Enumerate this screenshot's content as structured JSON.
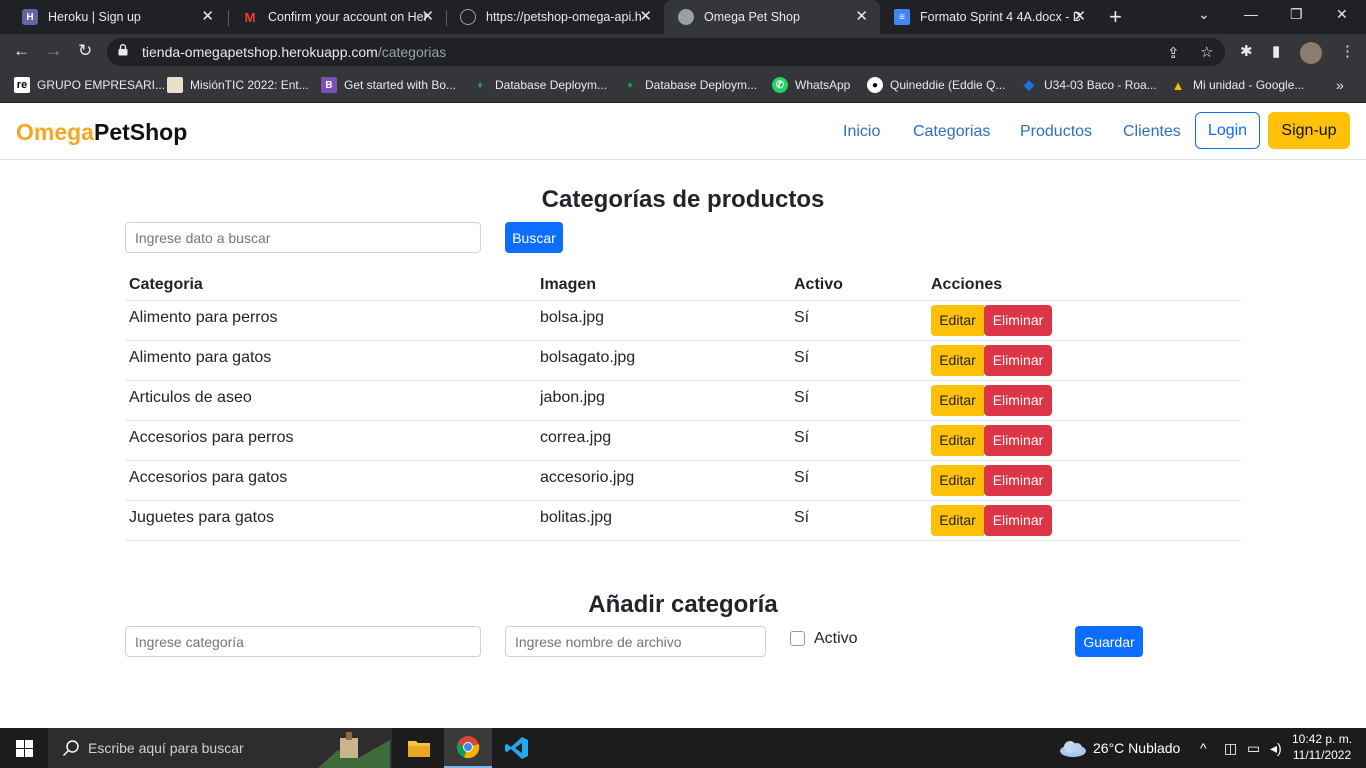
{
  "browser": {
    "tabs": [
      {
        "title": "Heroku | Sign up",
        "icon": "heroku-icon",
        "color": "#6762a6"
      },
      {
        "title": "Confirm your account on Her",
        "icon": "gmail-icon",
        "color": "#ea4335"
      },
      {
        "title": "https://petshop-omega-api.h",
        "icon": "globe-icon",
        "color": "#9aa0a6"
      },
      {
        "title": "Omega Pet Shop",
        "icon": "globe-icon",
        "color": "#9aa0a6"
      },
      {
        "title": "Formato Sprint 4 4A.docx - D",
        "icon": "docs-icon",
        "color": "#4285f4"
      }
    ],
    "url_host": "tienda-omegapetshop.herokuapp.com",
    "url_path": "/categorias",
    "bookmarks": [
      {
        "label": "GRUPO EMPRESARI...",
        "icon": "re-icon"
      },
      {
        "label": "MisiónTIC 2022: Ent...",
        "icon": "misiontic-icon"
      },
      {
        "label": "Get started with Bo...",
        "icon": "bootstrap-icon"
      },
      {
        "label": "Database Deploym...",
        "icon": "mongodb-icon"
      },
      {
        "label": "Database Deploym...",
        "icon": "mongodb-icon"
      },
      {
        "label": "WhatsApp",
        "icon": "whatsapp-icon"
      },
      {
        "label": "Quineddie (Eddie Q...",
        "icon": "github-icon"
      },
      {
        "label": "U34-03 Baco - Roa...",
        "icon": "diamond-icon"
      },
      {
        "label": "Mi unidad - Google...",
        "icon": "drive-icon"
      }
    ]
  },
  "site": {
    "brand_part1": "Omega",
    "brand_part2": "PetShop",
    "nav": [
      "Inicio",
      "Categorias",
      "Productos",
      "Clientes"
    ],
    "login": "Login",
    "signup": "Sign-up"
  },
  "list": {
    "title": "Categorías de productos",
    "search_placeholder": "Ingrese dato a buscar",
    "search_button": "Buscar",
    "columns": [
      "Categoria",
      "Imagen",
      "Activo",
      "Acciones"
    ],
    "rows": [
      {
        "categoria": "Alimento para perros",
        "imagen": "bolsa.jpg",
        "activo": "Sí"
      },
      {
        "categoria": "Alimento para gatos",
        "imagen": "bolsagato.jpg",
        "activo": "Sí"
      },
      {
        "categoria": "Articulos de aseo",
        "imagen": "jabon.jpg",
        "activo": "Sí"
      },
      {
        "categoria": "Accesorios para perros",
        "imagen": "correa.jpg",
        "activo": "Sí"
      },
      {
        "categoria": "Accesorios para gatos",
        "imagen": "accesorio.jpg",
        "activo": "Sí"
      },
      {
        "categoria": "Juguetes para gatos",
        "imagen": "bolitas.jpg",
        "activo": "Sí"
      }
    ],
    "edit_label": "Editar",
    "delete_label": "Eliminar"
  },
  "form": {
    "title": "Añadir categoría",
    "category_placeholder": "Ingrese categoría",
    "file_placeholder": "Ingrese nombre de archivo",
    "active_label": "Activo",
    "active_checked": false,
    "save_button": "Guardar"
  },
  "taskbar": {
    "search_placeholder": "Escribe aquí para buscar",
    "weather": "26°C  Nublado",
    "time": "10:42 p. m.",
    "date": "11/11/2022"
  }
}
